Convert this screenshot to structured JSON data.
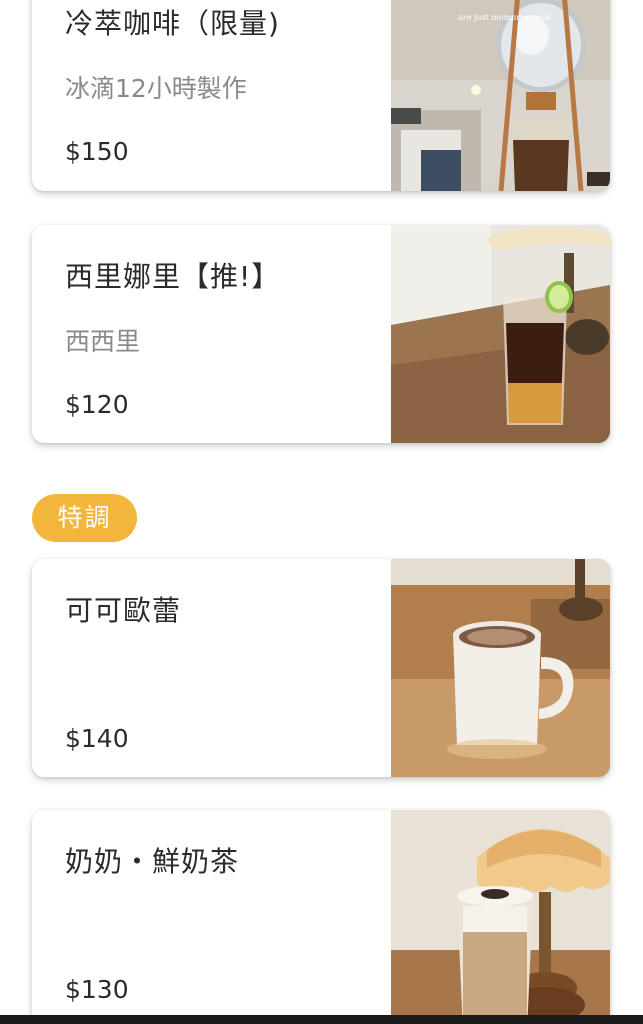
{
  "items": [
    {
      "name": "冷萃咖啡（限量)",
      "description": "冰滴12小時製作",
      "price": "$150",
      "photo_caption": "are just memories now"
    },
    {
      "name": "西里娜里【推!】",
      "description": "西西里",
      "price": "$120"
    },
    {
      "name": "可可歐蕾",
      "description": "",
      "price": "$140"
    },
    {
      "name": "奶奶・鮮奶茶",
      "description": "",
      "price": "$130"
    }
  ],
  "section": {
    "label": "特調",
    "color": "#f2b63d"
  }
}
